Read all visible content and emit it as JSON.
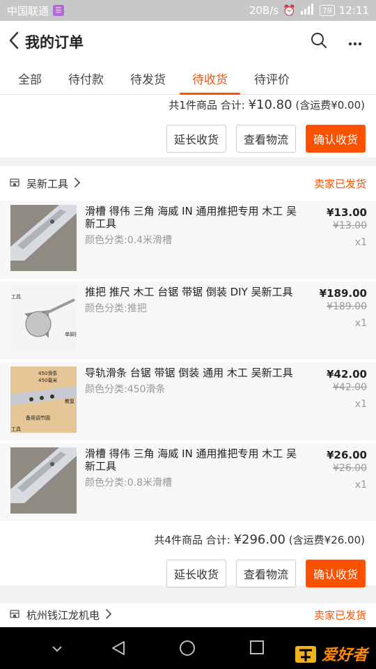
{
  "status_bar": {
    "carrier": "中国联通",
    "speed": "20B/s",
    "battery": "79",
    "time": "12:11"
  },
  "header": {
    "title": "我的订单"
  },
  "tabs": [
    {
      "label": "全部"
    },
    {
      "label": "待付款"
    },
    {
      "label": "待发货"
    },
    {
      "label": "待收货",
      "active": true
    },
    {
      "label": "待评价"
    }
  ],
  "order1": {
    "count": "共1件商品",
    "total_label": "合计:",
    "total": "¥10.80",
    "shipping": "(含运费¥0.00)",
    "buttons": {
      "extend": "延长收货",
      "logistics": "查看物流",
      "confirm": "确认收货"
    }
  },
  "order2": {
    "shop": "吴新工具",
    "status": "卖家已发货",
    "items": [
      {
        "name": "滑槽 得伟 三角 海威 IN 通用推把专用 木工 吴新工具",
        "spec": "颜色分类:0.4米滑槽",
        "price": "¥13.00",
        "orig": "¥13.00",
        "qty": "x1"
      },
      {
        "name": "推把 推尺 木工 台锯 带锯 倒装 DIY 吴新工具",
        "spec": "颜色分类:推把",
        "price": "¥189.00",
        "orig": "¥189.00",
        "qty": "x1"
      },
      {
        "name": "导轨滑条 台锯 带锯 倒装 通用 木工 吴新工具",
        "spec": "颜色分类:450滑条",
        "price": "¥42.00",
        "orig": "¥42.00",
        "qty": "x1"
      },
      {
        "name": "滑槽 得伟 三角 海威 IN 通用推把专用 木工 吴新工具",
        "spec": "颜色分类:0.8米滑槽",
        "price": "¥26.00",
        "orig": "¥26.00",
        "qty": "x1"
      }
    ],
    "count": "共4件商品",
    "total_label": "合计:",
    "total": "¥296.00",
    "shipping": "(含运费¥26.00)",
    "buttons": {
      "extend": "延长收货",
      "logistics": "查看物流",
      "confirm": "确认收货"
    }
  },
  "order3": {
    "shop": "杭州钱江龙机电",
    "status": "卖家已发货"
  },
  "thumb_labels": {
    "t2": "单脚拐",
    "t3a": "450滑条",
    "t3b": "450毫米",
    "t3c": "教复",
    "t3d": "备用调节圆",
    "t3e": "工具",
    "t2b": "工具"
  },
  "watermark": {
    "logo_text": "爱好者"
  },
  "colors": {
    "accent": "#ff5000",
    "status_bar": "#c8c8c8"
  },
  "icons": [
    "back-icon",
    "search-icon",
    "more-icon",
    "shop-icon",
    "chevron-right-icon",
    "nav-down-icon",
    "nav-back-icon",
    "nav-home-icon",
    "nav-recent-icon"
  ]
}
